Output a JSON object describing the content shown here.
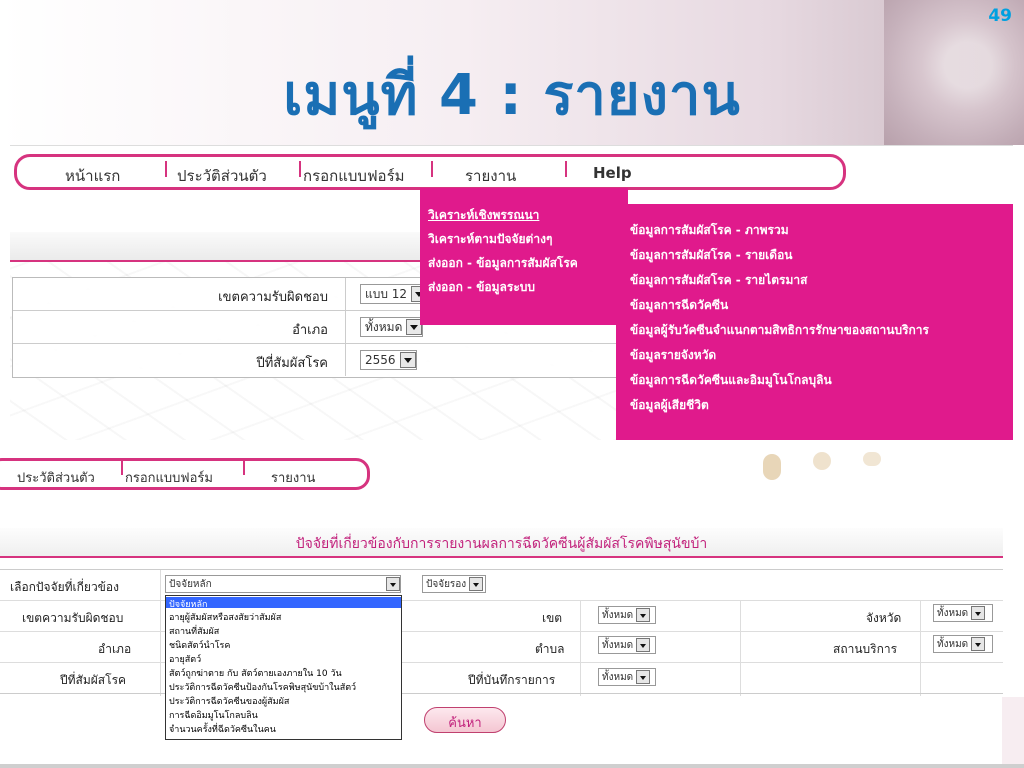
{
  "slide": {
    "number": "49",
    "title": "เมนูที่ 4 : รายงาน"
  },
  "top_nav": [
    "หน้าแรก",
    "ประวัติส่วนตัว",
    "กรอกแบบฟอร์ม",
    "รายงาน",
    "Help"
  ],
  "top_filters": [
    {
      "label": "เขตความรับผิดชอบ",
      "value": "แบบ 12"
    },
    {
      "label": "อำเภอ",
      "value": "ทั้งหมด"
    },
    {
      "label": "ปีที่สัมผัสโรค",
      "value": "2556"
    }
  ],
  "report_menu": [
    "วิเคราะห์เชิงพรรณนา",
    "วิเคราะห์ตามปัจจัยต่างๆ",
    "ส่งออก - ข้อมูลการสัมผัสโรค",
    "ส่งออก - ข้อมูลระบบ"
  ],
  "export_submenu": [
    "ข้อมูลการสัมผัสโรค - ภาพรวม",
    "ข้อมูลการสัมผัสโรค - รายเดือน",
    "ข้อมูลการสัมผัสโรค - รายไตรมาส",
    "ข้อมูลการฉีดวัคซีน",
    "ข้อมูลผู้รับวัคซีนจำแนกตามสิทธิการรักษาของสถานบริการ",
    "ข้อมูลรายจังหวัด",
    "ข้อมูลการฉีดวัคซีนและอิมมูโนโกลบุลิน",
    "ข้อมูลผู้เสียชีวิต"
  ],
  "second_nav": [
    "ประวัติส่วนตัว",
    "กรอกแบบฟอร์ม",
    "รายงาน"
  ],
  "factor_form": {
    "title": "ปัจจัยที่เกี่ยวข้องกับการรายงานผลการฉีดวัคซีนผู้สัมผัสโรคพิษสุนัขบ้า",
    "select_factor_label": "เลือกปัจจัยที่เกี่ยวข้อง",
    "main_factor_value": "ปัจจัยหลัก",
    "sub_factor_value": "ปัจจัยรอง",
    "labels": {
      "responsibility": "เขตความรับผิดชอบ",
      "district": "อำเภอ",
      "exposure_year": "ปีที่สัมผัสโรค",
      "zone": "เขต",
      "subdistrict": "ตำบล",
      "record_year": "ปีที่บันทึกรายการ",
      "province": "จังหวัด",
      "service_unit": "สถานบริการ"
    },
    "all_value": "ทั้งหมด",
    "search_button": "ค้นหา"
  },
  "factor_options": [
    "ปัจจัยหลัก",
    "อายุผู้สัมผัสหรือสงสัยว่าสัมผัส",
    "สถานที่สัมผัส",
    "ชนิดสัตว์นำโรค",
    "อายุสัตว์",
    "สัตว์ถูกฆ่าตาย กับ สัตว์ตายเองภายใน 10 วัน",
    "ประวัติการฉีดวัคซีนป้องกันโรคพิษสุนัขบ้าในสัตว์",
    "ประวัติการฉีดวัคซีนของผู้สัมผัส",
    "การฉีดอิมมูโนโกลบลิน",
    "จำนวนครั้งที่ฉีดวัคซีนในคน"
  ],
  "colors": {
    "accent": "#d6337f",
    "menu": "#e01a8c",
    "title": "#1a6fb4",
    "slide_number": "#00a0e0"
  }
}
